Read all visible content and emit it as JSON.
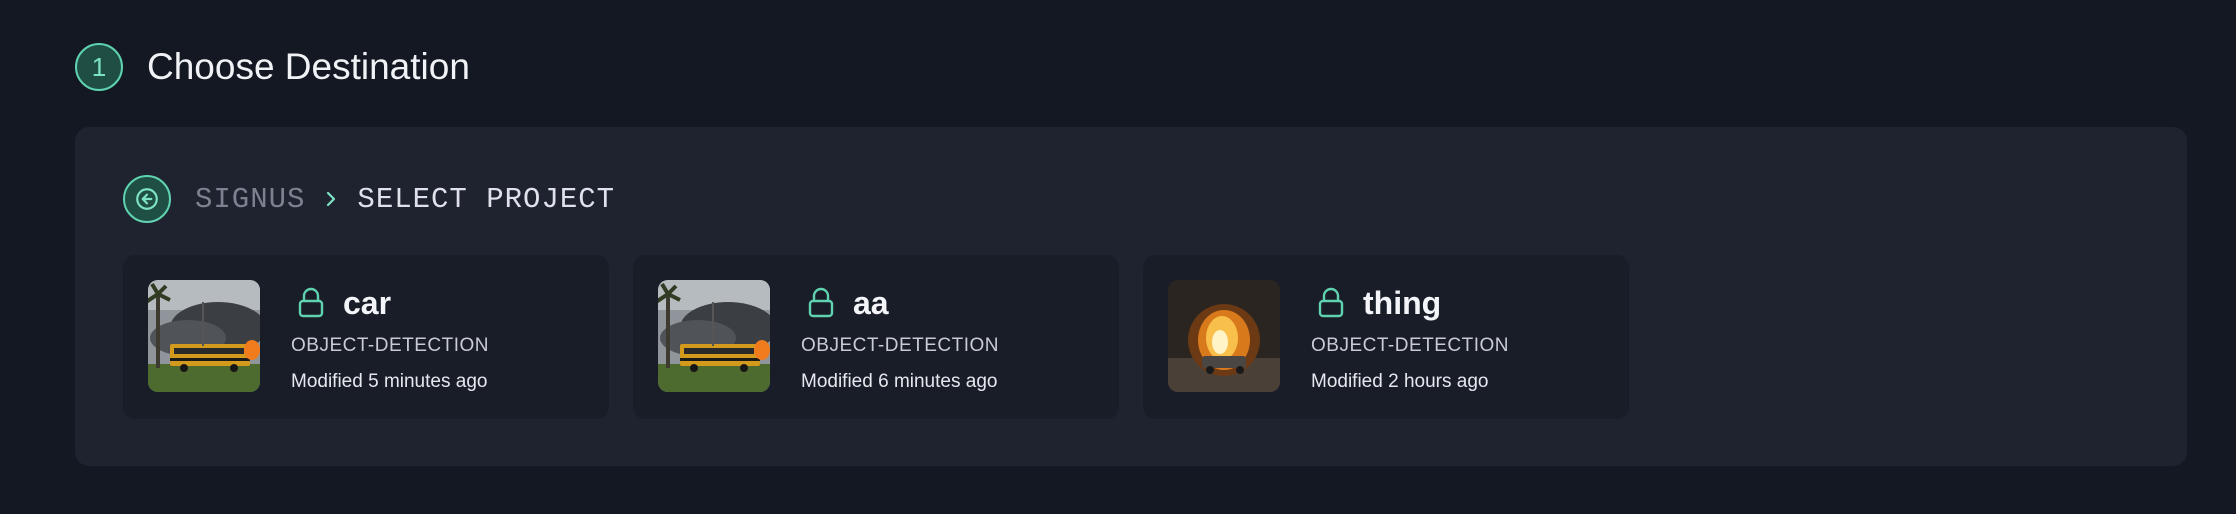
{
  "step": {
    "number": "1",
    "title": "Choose Destination"
  },
  "breadcrumb": {
    "root": "SIGNUS",
    "current": "SELECT PROJECT"
  },
  "projects": [
    {
      "name": "car",
      "type": "OBJECT-DETECTION",
      "modified": "Modified 5 minutes ago",
      "thumbnail": "bus-fire-image"
    },
    {
      "name": "aa",
      "type": "OBJECT-DETECTION",
      "modified": "Modified 6 minutes ago",
      "thumbnail": "bus-fire-image"
    },
    {
      "name": "thing",
      "type": "OBJECT-DETECTION",
      "modified": "Modified 2 hours ago",
      "thumbnail": "car-fire-image"
    }
  ],
  "colors": {
    "background": "#141823",
    "panel": "#1f2330",
    "card": "#191d28",
    "accent": "#5fd3b0"
  },
  "icons": {
    "back": "arrow-left-icon",
    "separator": "chevron-right-icon",
    "project": "lock-icon"
  }
}
